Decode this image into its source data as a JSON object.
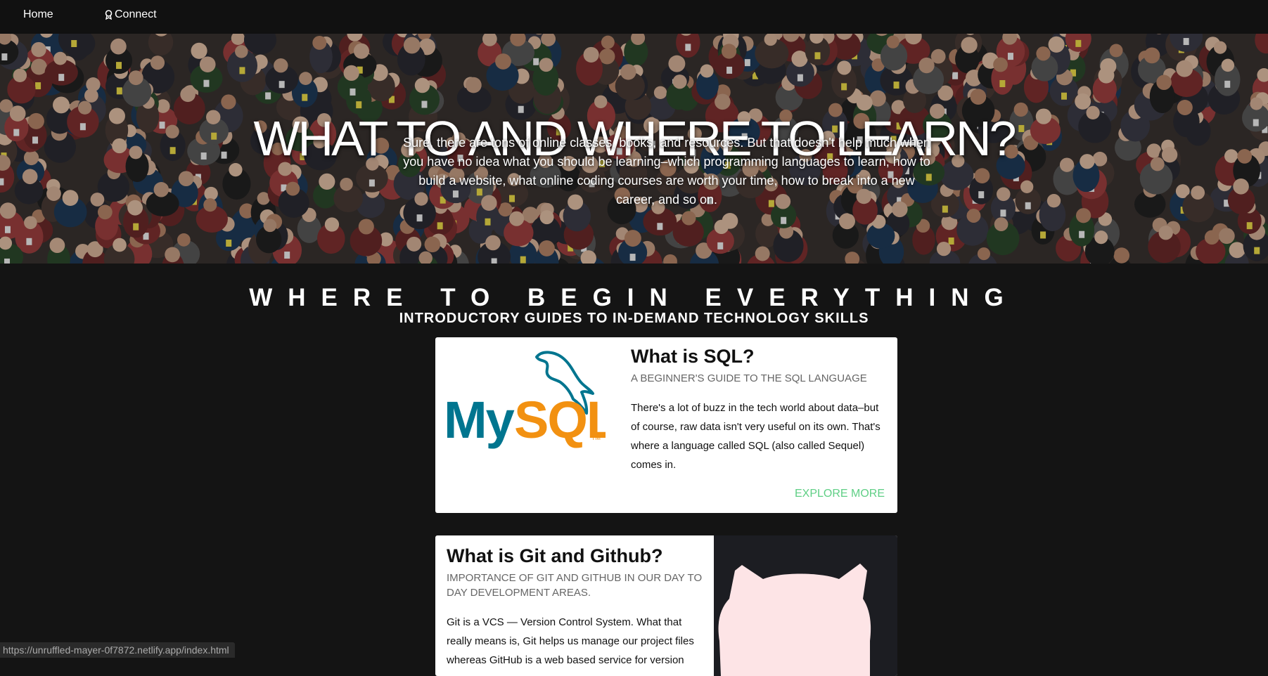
{
  "nav": {
    "home_label": "Home",
    "connect_label": "Connect",
    "connect_icon": "award-icon"
  },
  "hero": {
    "title": "WHAT TO AND WHERE TO LEARN?",
    "text": "Sure, there are tons of online classes, books, and resources. But that doesn't help much when you have no idea what you should be learning–which programming languages to learn, how to build a website, what online coding courses are worth your time, how to break into a new career, and so on."
  },
  "section": {
    "title": "WHERE TO BEGIN EVERYTHING",
    "subtitle": "INTRODUCTORY GUIDES TO IN-DEMAND TECHNOLOGY SKILLS"
  },
  "cards": [
    {
      "title": "What is SQL?",
      "subtitle": "A BEGINNER'S GUIDE TO THE SQL LANGUAGE",
      "text": "There's a lot of buzz in the tech world about data–but of course, raw data isn't very useful on its own. That's where a language called SQL (also called Sequel) comes in.",
      "link": "EXPLORE MORE",
      "logo_text": "MySQL",
      "logo_tm": "TM",
      "colors": {
        "my": "#00758f",
        "sql": "#f29111"
      }
    },
    {
      "title": "What is Git and Github?",
      "subtitle": "IMPORTANCE OF GIT AND GITHUB IN OUR DAY TO DAY DEVELOPMENT AREAS.",
      "text": "Git is a VCS — Version Control System. What that really means is, Git helps us manage our project files whereas GitHub is a web based service for version"
    }
  ],
  "status_bar": {
    "url": "https://unruffled-mayer-0f7872.netlify.app/index.html"
  }
}
